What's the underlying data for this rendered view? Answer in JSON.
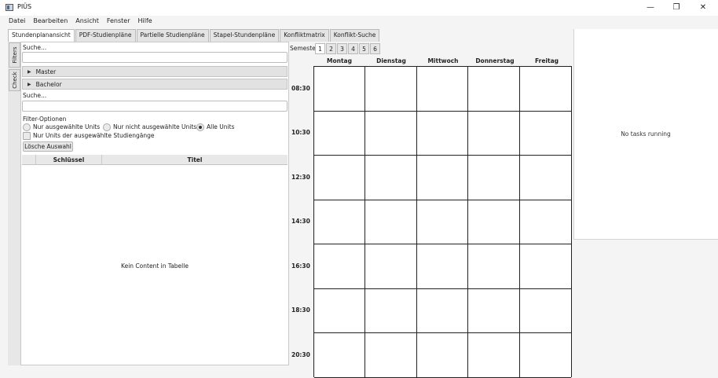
{
  "window": {
    "title": "PIÜS",
    "minimize_glyph": "—",
    "maximize_glyph": "❐",
    "close_glyph": "✕"
  },
  "menu": [
    "Datei",
    "Bearbeiten",
    "Ansicht",
    "Fenster",
    "Hilfe"
  ],
  "tabs": [
    {
      "label": "Stundenplanansicht",
      "active": true
    },
    {
      "label": "PDF-Studienpläne",
      "active": false
    },
    {
      "label": "Partielle Studienpläne",
      "active": false
    },
    {
      "label": "Stapel-Stundenpläne",
      "active": false
    },
    {
      "label": "Konfliktmatrix",
      "active": false
    },
    {
      "label": "Konflikt-Suche",
      "active": false
    }
  ],
  "side_tabs": {
    "filters": "Filters",
    "check": "Check"
  },
  "left": {
    "search1_label": "Suche...",
    "search1_value": "",
    "accordion": [
      {
        "label": "Master",
        "arrow": "▶"
      },
      {
        "label": "Bachelor",
        "arrow": "▶"
      }
    ],
    "search2_label": "Suche...",
    "search2_value": "",
    "filter_options_label": "Filter-Optionen",
    "radios": [
      {
        "label": "Nur ausgewählte Units",
        "selected": false
      },
      {
        "label": "Nur nicht ausgewählte Units",
        "selected": false
      },
      {
        "label": "Alle Units",
        "selected": true
      }
    ],
    "checkbox_label": "Nur Units der ausgewählte Studiengänge",
    "clear_button": "Lösche Auswahl",
    "table": {
      "columns": [
        "Schlüssel",
        "Titel"
      ],
      "empty_text": "Kein Content in Tabelle"
    }
  },
  "schedule": {
    "semester_label": "Semester:",
    "semesters": [
      "1",
      "2",
      "3",
      "4",
      "5",
      "6"
    ],
    "active_semester": "1",
    "days": [
      "Montag",
      "Dienstag",
      "Mittwoch",
      "Donnerstag",
      "Freitag"
    ],
    "times": [
      "08:30",
      "10:30",
      "12:30",
      "14:30",
      "16:30",
      "18:30",
      "20:30"
    ]
  },
  "tasks": {
    "status": "No tasks running"
  }
}
